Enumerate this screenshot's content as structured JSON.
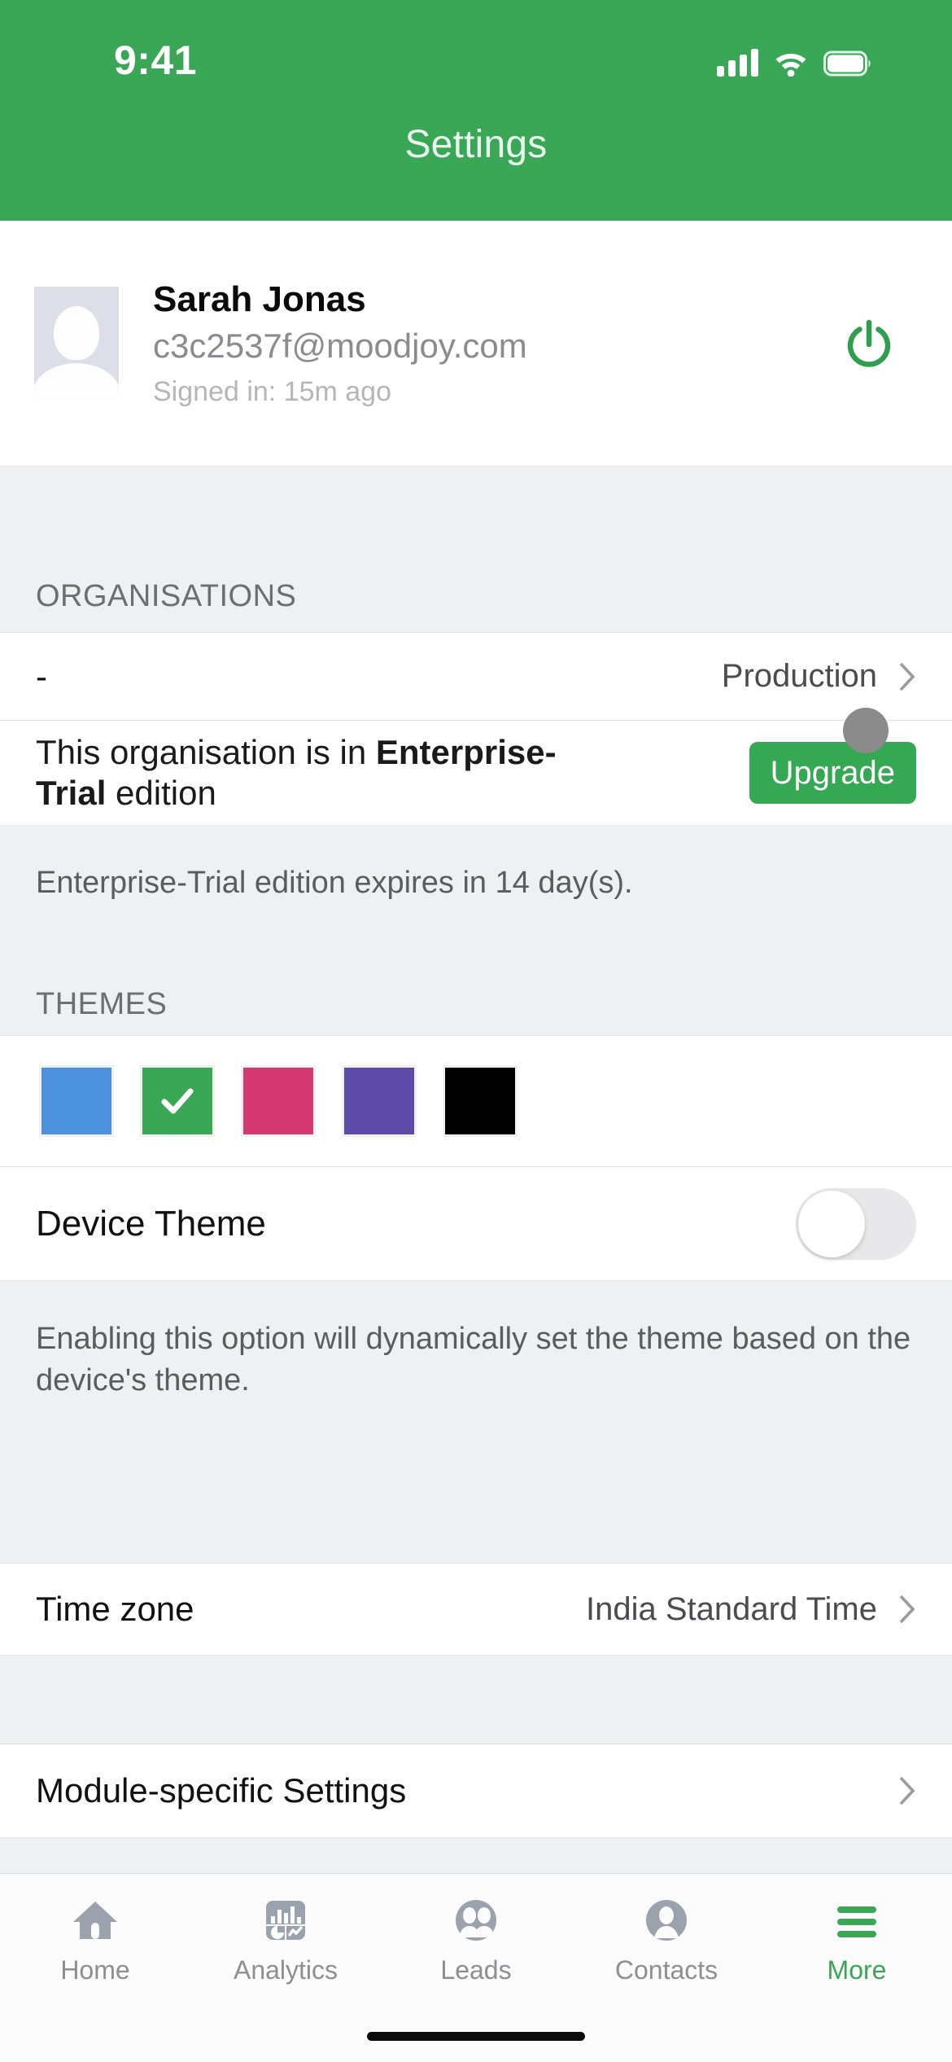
{
  "status_bar": {
    "time": "9:41",
    "signal_icon": "cellular-signal-icon",
    "wifi_icon": "wifi-icon",
    "battery_icon": "battery-icon"
  },
  "header": {
    "title": "Settings",
    "background_color": "#3aa757"
  },
  "profile": {
    "name": "Sarah Jonas",
    "email": "c3c2537f@moodjoy.com",
    "signed_in": "Signed in: 15m ago",
    "avatar_icon": "user-placeholder-avatar",
    "power_icon": "power-sign-out-icon",
    "power_color": "#2f9e4f"
  },
  "organisations": {
    "section_title": "ORGANISATIONS",
    "org_row": {
      "label": "-",
      "value": "Production",
      "chevron_icon": "chevron-right-icon"
    },
    "edition_row": {
      "text_prefix": "This organisation is in ",
      "text_bold": "Enterprise-Trial",
      "text_suffix": " edition",
      "upgrade_label": "Upgrade",
      "upgrade_color": "#34a853"
    },
    "expiry_note": "Enterprise-Trial edition expires in 14 day(s)."
  },
  "themes": {
    "section_title": "THEMES",
    "swatches": [
      {
        "name": "blue",
        "color": "#4b91dd",
        "selected": false
      },
      {
        "name": "green",
        "color": "#3aa757",
        "selected": true
      },
      {
        "name": "pink",
        "color": "#d6396f",
        "selected": false
      },
      {
        "name": "purple",
        "color": "#5b4aa8",
        "selected": false
      },
      {
        "name": "black",
        "color": "#000000",
        "selected": false
      }
    ],
    "check_icon": "check-icon"
  },
  "device_theme": {
    "label": "Device Theme",
    "enabled": false,
    "description": "Enabling this option will dynamically set the theme based on the device's theme."
  },
  "time_zone": {
    "label": "Time zone",
    "value": "India Standard Time",
    "chevron_icon": "chevron-right-icon"
  },
  "module_settings": {
    "label": "Module-specific Settings",
    "chevron_icon": "chevron-right-icon"
  },
  "tabbar": {
    "active_color": "#3aa757",
    "inactive_color": "#8e8e93",
    "tabs": [
      {
        "label": "Home",
        "icon": "home-icon",
        "active": false
      },
      {
        "label": "Analytics",
        "icon": "analytics-chart-icon",
        "active": false
      },
      {
        "label": "Leads",
        "icon": "leads-people-icon",
        "active": false
      },
      {
        "label": "Contacts",
        "icon": "contact-person-icon",
        "active": false
      },
      {
        "label": "More",
        "icon": "hamburger-menu-icon",
        "active": true
      }
    ]
  }
}
